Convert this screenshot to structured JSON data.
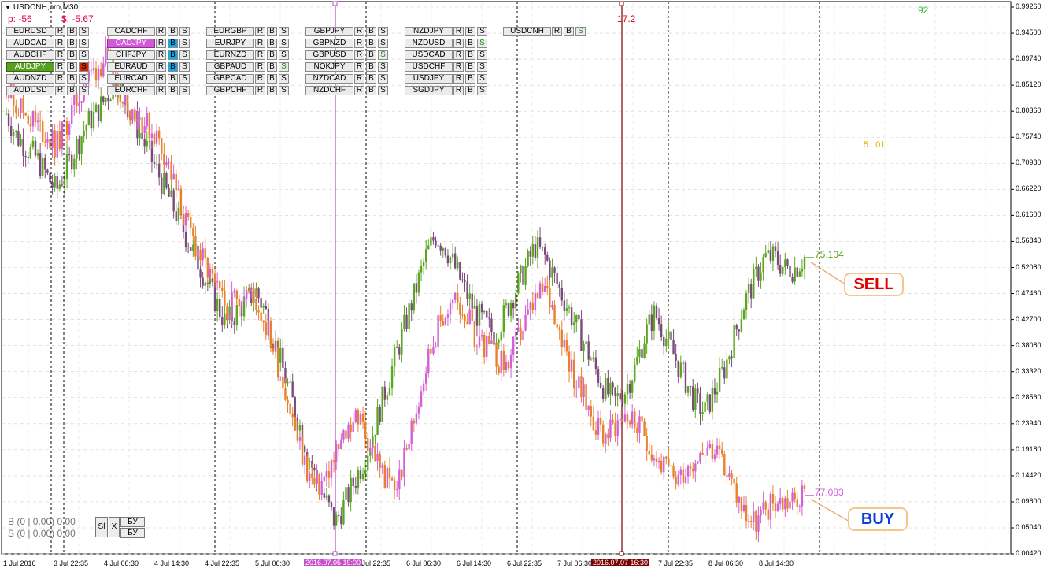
{
  "header": {
    "symbol_timeframe": "USDCNH,pro,M30",
    "profit_points": "p: -56",
    "profit_money": "$: -5.67",
    "counter": "92",
    "timer": "5 : 01",
    "marker_value": "17.2"
  },
  "pairs": [
    [
      "EURUSD",
      "CADCHF",
      "EURGBP",
      "GBPJPY",
      "NZDJPY",
      "USDCNH"
    ],
    [
      "AUDCAD",
      "CADJPY",
      "EURJPY",
      "GBPNZD",
      "NZDUSD"
    ],
    [
      "AUDCHF",
      "CHFJPY",
      "EURNZD",
      "GBPUSD",
      "USDCAD"
    ],
    [
      "AUDJPY",
      "EURAUD",
      "GBPAUD",
      "NOKJPY",
      "USDCHF"
    ],
    [
      "AUDNZD",
      "EURCAD",
      "GBPCAD",
      "NZDCAD",
      "USDJPY"
    ],
    [
      "AUDUSD",
      "EURCHF",
      "GBPCHF",
      "NZDCHF",
      "SGDJPY"
    ]
  ],
  "active_pair": "AUDJPY",
  "selected_pair": "CADJPY",
  "button_labels": {
    "r": "R",
    "b": "B",
    "s": "S"
  },
  "signals": {
    "sell_label": "SELL",
    "buy_label": "BUY",
    "sell_value": "75.104",
    "buy_value": "77.083"
  },
  "status": {
    "buy_line": "B (0 | 0.00)  0.00",
    "sell_line": "S (0 | 0.00)  0.00",
    "sl_label": "Sl",
    "x_label": "X",
    "bu1_label": "БУ",
    "bu2_label": "БУ"
  },
  "y_axis": [
    "0.99260",
    "0.94500",
    "0.89740",
    "0.85120",
    "0.80360",
    "0.75740",
    "0.70980",
    "0.66220",
    "0.61600",
    "0.56840",
    "0.52080",
    "0.47460",
    "0.42700",
    "0.38080",
    "0.33320",
    "0.28560",
    "0.23940",
    "0.19180",
    "0.14420",
    "0.09800",
    "0.05040",
    "0.00420"
  ],
  "x_axis": [
    "1 Jul 2016",
    "3 Jul 22:35",
    "4 Jul 06:30",
    "4 Jul 14:30",
    "4 Jul 22:35",
    "5 Jul 06:30",
    "5 Jul 22:35",
    "6 Jul 06:30",
    "6 Jul 14:30",
    "6 Jul 22:35",
    "7 Jul 06:30",
    "7 Jul 22:35",
    "8 Jul 06:30",
    "8 Jul 14:30"
  ],
  "vline_labels": {
    "purple": "2016.07.05 19:00",
    "red": "2016.07.07 16:30"
  },
  "colors": {
    "up1": "#5aa61f",
    "down1": "#7a4b7a",
    "up2": "#d45fd6",
    "down2": "#e8822a",
    "purple_line": "#b24bc1",
    "red_line": "#7a0000",
    "grid": "#cfcfcf"
  },
  "chart_data": {
    "type": "candlestick",
    "ylim": [
      0.0042,
      0.9926
    ],
    "series": [
      {
        "values": [
          0.8,
          0.76,
          0.74,
          0.72,
          0.69,
          0.66,
          0.7,
          0.74,
          0.78,
          0.8,
          0.83,
          0.86,
          0.82,
          0.78,
          0.74,
          0.7,
          0.66,
          0.62,
          0.58,
          0.54,
          0.5,
          0.46,
          0.42,
          0.44,
          0.46,
          0.48,
          0.44,
          0.38,
          0.32,
          0.26,
          0.2,
          0.14,
          0.1,
          0.06,
          0.1,
          0.14,
          0.18,
          0.24,
          0.3,
          0.36,
          0.42,
          0.48,
          0.54,
          0.58,
          0.56,
          0.52,
          0.48,
          0.44,
          0.42,
          0.4,
          0.44,
          0.48,
          0.52,
          0.56,
          0.54,
          0.5,
          0.46,
          0.42,
          0.38,
          0.34,
          0.3,
          0.28,
          0.3,
          0.34,
          0.4,
          0.44,
          0.4,
          0.36,
          0.32,
          0.28,
          0.26,
          0.3,
          0.34,
          0.4,
          0.46,
          0.5,
          0.54,
          0.54,
          0.52,
          0.52,
          0.54
        ]
      },
      {
        "values": [
          0.86,
          0.82,
          0.8,
          0.78,
          0.76,
          0.74,
          0.78,
          0.82,
          0.86,
          0.88,
          0.9,
          0.86,
          0.82,
          0.8,
          0.78,
          0.76,
          0.72,
          0.66,
          0.6,
          0.56,
          0.52,
          0.48,
          0.45,
          0.47,
          0.48,
          0.46,
          0.42,
          0.36,
          0.3,
          0.22,
          0.16,
          0.12,
          0.14,
          0.18,
          0.22,
          0.26,
          0.22,
          0.18,
          0.14,
          0.12,
          0.18,
          0.26,
          0.34,
          0.4,
          0.44,
          0.46,
          0.44,
          0.4,
          0.38,
          0.36,
          0.34,
          0.38,
          0.42,
          0.46,
          0.48,
          0.44,
          0.38,
          0.32,
          0.28,
          0.24,
          0.22,
          0.24,
          0.26,
          0.24,
          0.22,
          0.18,
          0.16,
          0.14,
          0.16,
          0.18,
          0.2,
          0.18,
          0.16,
          0.12,
          0.08,
          0.06,
          0.08,
          0.1,
          0.1,
          0.1,
          0.11
        ]
      }
    ]
  }
}
